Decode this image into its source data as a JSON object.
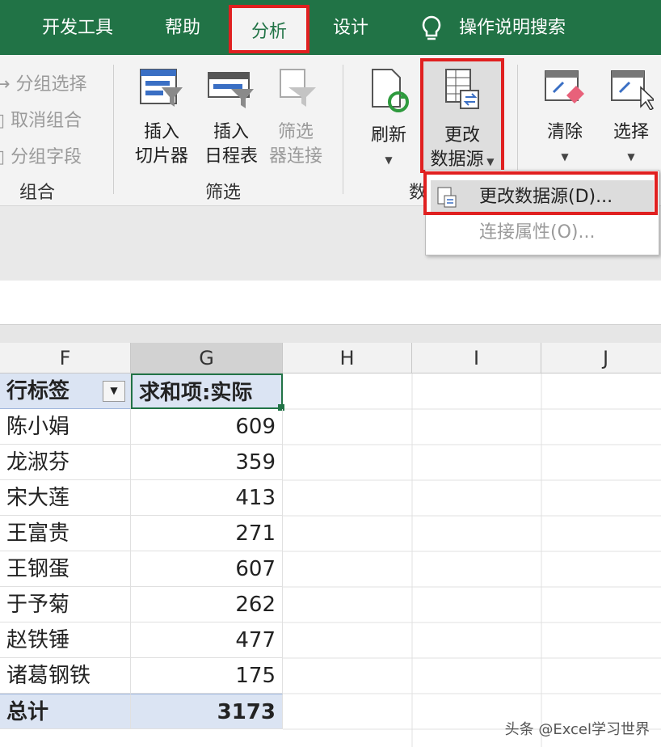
{
  "tabs": [
    "开发工具",
    "帮助",
    "分析",
    "设计"
  ],
  "tell_me": "操作说明搜索",
  "ribbon": {
    "group_items": [
      "分组选择",
      "取消组合",
      "分组字段"
    ],
    "group_label": "组合",
    "slicer": [
      "插入",
      "切片器"
    ],
    "timeline": [
      "插入",
      "日程表"
    ],
    "filter_conn": [
      "筛选",
      "器连接"
    ],
    "filter_label": "筛选",
    "refresh": "刷新",
    "change_source": [
      "更改",
      "数据源"
    ],
    "data_label_partial": "数",
    "clear": "清除",
    "select": "选择"
  },
  "menu": {
    "item1": "更改数据源(D)...",
    "item2": "连接属性(O)..."
  },
  "columns": [
    "F",
    "G",
    "H",
    "I",
    "J"
  ],
  "pivot": {
    "row_label_header": "行标签",
    "value_header": "求和项:实际",
    "rows": [
      {
        "name": "陈小娟",
        "value": "609"
      },
      {
        "name": "龙淑芬",
        "value": "359"
      },
      {
        "name": "宋大莲",
        "value": "413"
      },
      {
        "name": "王富贵",
        "value": "271"
      },
      {
        "name": "王钢蛋",
        "value": "607"
      },
      {
        "name": "于予菊",
        "value": "262"
      },
      {
        "name": "赵铁锤",
        "value": "477"
      },
      {
        "name": "诸葛钢铁",
        "value": "175"
      }
    ],
    "total_label": "总计",
    "total_value": "3173"
  },
  "watermark": "头条 @Excel学习世界",
  "colors": {
    "excel_green": "#217346",
    "highlight_red": "#e02020",
    "pivot_header_blue": "#dbe4f3"
  }
}
